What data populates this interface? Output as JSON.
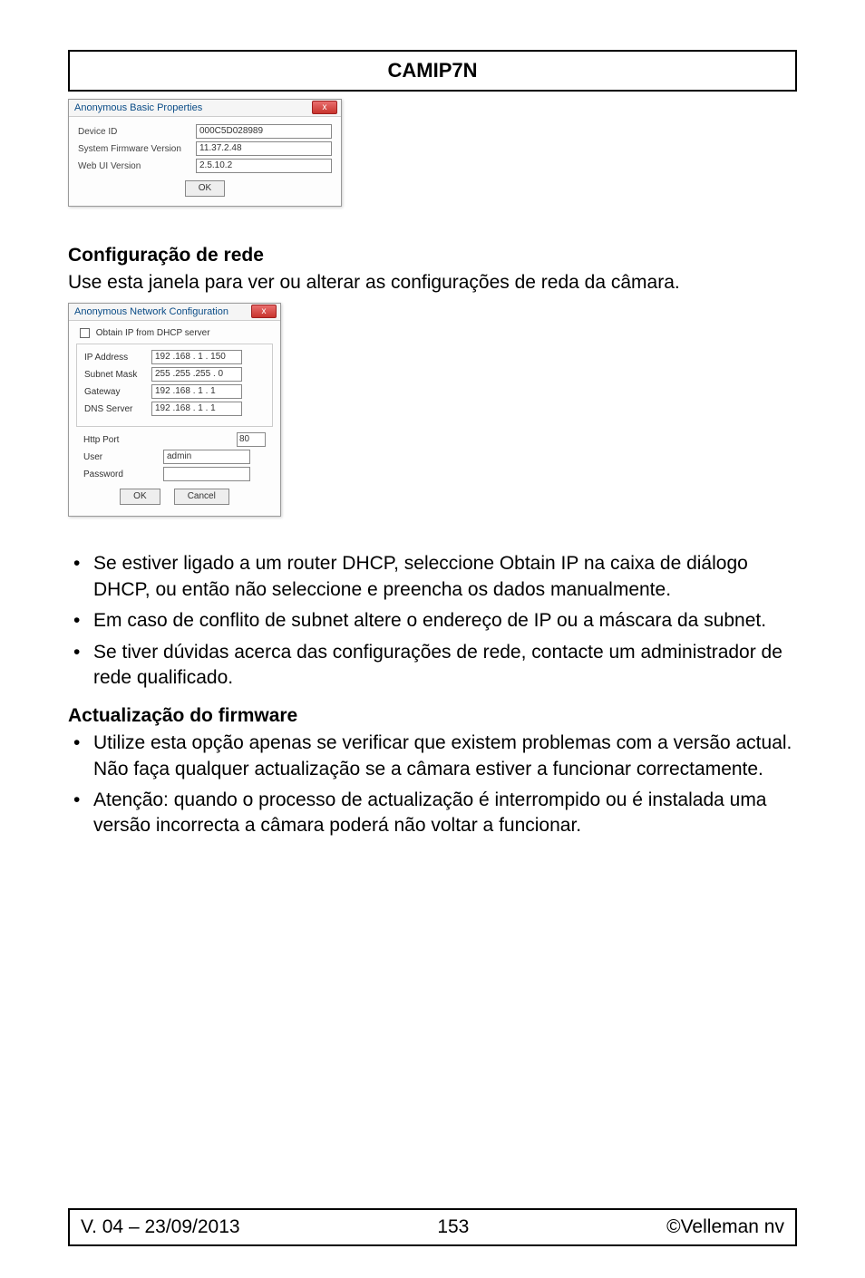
{
  "header": {
    "title": "CAMIP7N"
  },
  "dialog1": {
    "title": "Anonymous Basic Properties",
    "close": "x",
    "fields": {
      "device_id_label": "Device ID",
      "device_id_value": "000C5D028989",
      "fw_label": "System Firmware Version",
      "fw_value": "11.37.2.48",
      "web_label": "Web UI Version",
      "web_value": "2.5.10.2"
    },
    "ok_label": "OK"
  },
  "section1": {
    "heading": "Configuração de rede",
    "text": "Use esta janela para ver ou alterar as configurações de reda da câmara."
  },
  "dialog2": {
    "title": "Anonymous Network Configuration",
    "close": "x",
    "dhcp_label": "Obtain IP from DHCP server",
    "ip_label": "IP Address",
    "ip_value": "192 .168 . 1 . 150",
    "subnet_label": "Subnet Mask",
    "subnet_value": "255 .255 .255 . 0",
    "gateway_label": "Gateway",
    "gateway_value": "192 .168 . 1 .  1",
    "dns_label": "DNS Server",
    "dns_value": "192 .168 . 1 .  1",
    "http_label": "Http Port",
    "http_value": "80",
    "user_label": "User",
    "user_value": "admin",
    "password_label": "Password",
    "password_value": "",
    "ok_label": "OK",
    "cancel_label": "Cancel"
  },
  "bullets1": {
    "b1": "Se estiver ligado a um router DHCP, seleccione Obtain IP na caixa de diálogo DHCP, ou então não seleccione e preencha os dados manualmente.",
    "b2": "Em caso de conflito de subnet altere o endereço de IP ou a máscara da subnet.",
    "b3": "Se tiver dúvidas acerca das configurações de rede, contacte um administrador de rede qualificado."
  },
  "section2": {
    "heading": "Actualização do firmware"
  },
  "bullets2": {
    "b1": "Utilize esta opção apenas se verificar que existem problemas com a versão actual. Não faça qualquer actualização se a câmara estiver a funcionar correctamente.",
    "b2": "Atenção: quando o processo de actualização é interrompido ou é instalada uma versão incorrecta a câmara poderá não voltar a funcionar."
  },
  "footer": {
    "left": "V. 04 – 23/09/2013",
    "center": "153",
    "right": "©Velleman nv"
  }
}
